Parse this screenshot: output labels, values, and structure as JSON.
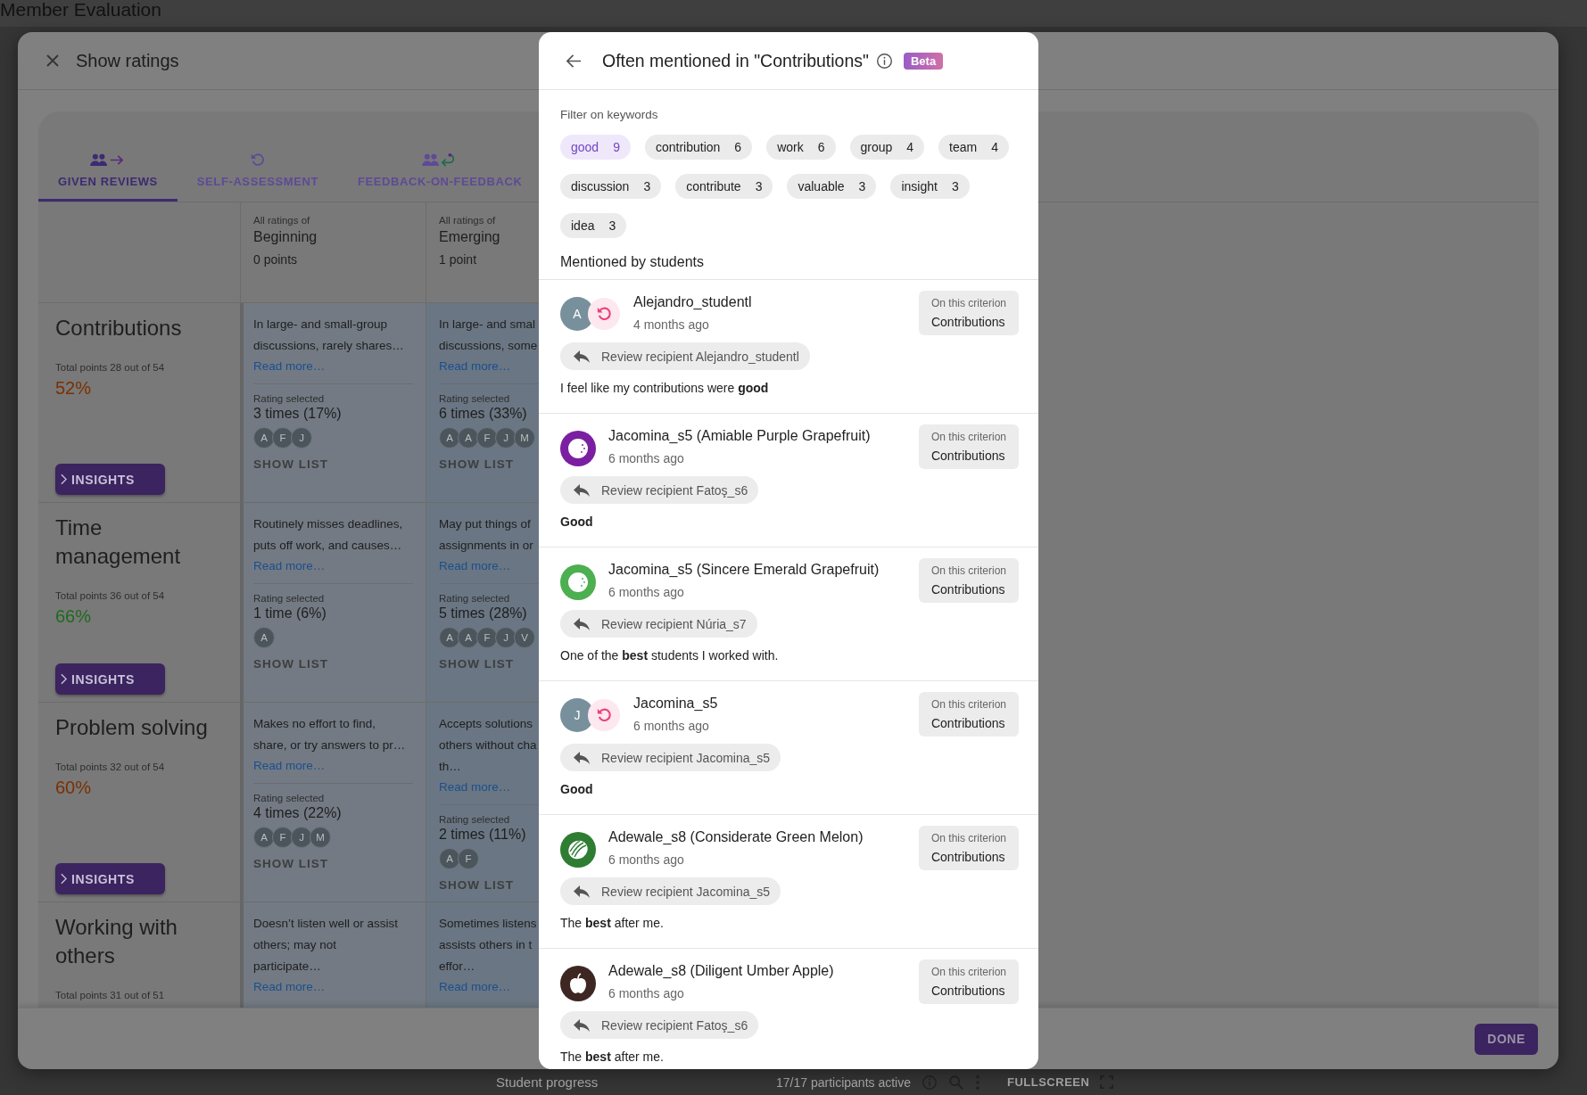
{
  "app_title": "Member Evaluation",
  "status_bar": {
    "section": "Student progress",
    "participants": "17/17 participants active",
    "fullscreen": "FULLSCREEN"
  },
  "ratings_dialog": {
    "title": "Show ratings",
    "done": "DONE",
    "tabs": [
      {
        "label": "GIVEN REVIEWS",
        "kind": "given",
        "selected": true
      },
      {
        "label": "SELF-ASSESSMENT",
        "kind": "self",
        "selected": false
      },
      {
        "label": "FEEDBACK-ON-FEEDBACK",
        "kind": "feedback",
        "selected": false
      }
    ],
    "levels": [
      {
        "caption": "All ratings of",
        "name": "Beginning",
        "points": "0 points"
      },
      {
        "caption": "All ratings of",
        "name": "Emerging",
        "points": "1 point"
      }
    ],
    "criteria": [
      {
        "name": "Contributions",
        "total": "Total points 28 out of 54",
        "percent": "52%",
        "color": "#7a3000",
        "insights": "INSIGHTS",
        "cells": [
          {
            "lines": [
              "In large- and small-group",
              "discussions, rarely shares…"
            ],
            "read_more": "Read more…",
            "rating_label": "Rating selected",
            "count": "3 times (17%)",
            "avatars": [
              "A",
              "F",
              "J"
            ],
            "show_list": "SHOW LIST"
          },
          {
            "lines": [
              "In large- and smal",
              "discussions, some"
            ],
            "read_more": "Read more…",
            "rating_label": "Rating selected",
            "count": "6 times (33%)",
            "avatars": [
              "A",
              "A",
              "F",
              "J",
              "M"
            ],
            "show_list": "SHOW LIST"
          }
        ]
      },
      {
        "name": "Time management",
        "total": "Total points 36 out of 54",
        "percent": "66%",
        "color": "#1f6a1f",
        "insights": "INSIGHTS",
        "cells": [
          {
            "lines": [
              "Routinely misses deadlines,",
              "puts off work, and causes…"
            ],
            "read_more": "Read more…",
            "rating_label": "Rating selected",
            "count": "1 time (6%)",
            "avatars": [
              "A"
            ],
            "show_list": "SHOW LIST"
          },
          {
            "lines": [
              "May put things of",
              "assignments in or"
            ],
            "read_more": "Read more…",
            "rating_label": "Rating selected",
            "count": "5 times (28%)",
            "avatars": [
              "A",
              "A",
              "F",
              "J",
              "V"
            ],
            "show_list": "SHOW LIST"
          }
        ]
      },
      {
        "name": "Problem solving",
        "total": "Total points 32 out of 54",
        "percent": "60%",
        "color": "#7a3000",
        "insights": "INSIGHTS",
        "cells": [
          {
            "lines": [
              "Makes no effort to find,",
              "share, or try answers to pr…"
            ],
            "read_more": "Read more…",
            "rating_label": "Rating selected",
            "count": "4 times (22%)",
            "avatars": [
              "A",
              "F",
              "J",
              "M"
            ],
            "show_list": "SHOW LIST"
          },
          {
            "lines": [
              "Accepts solutions",
              "others without cha",
              "th…"
            ],
            "read_more": "Read more…",
            "rating_label": "Rating selected",
            "count": "2 times (11%)",
            "avatars": [
              "A",
              "F"
            ],
            "show_list": "SHOW LIST"
          }
        ]
      },
      {
        "name": "Working with others",
        "total": "Total points 31 out of 51",
        "cells": [
          {
            "lines": [
              "Doesn’t listen well or assist",
              "others; may not",
              "participate…"
            ],
            "read_more": "Read more…"
          },
          {
            "lines": [
              "Sometimes listens",
              "assists others in t",
              "effor…"
            ],
            "read_more": "Read more…"
          }
        ]
      }
    ]
  },
  "mentions_panel": {
    "title": "Often mentioned in \"Contributions\"",
    "badge": "Beta",
    "filter_label": "Filter on keywords",
    "list_label": "Mentioned by students",
    "keywords": [
      {
        "label": "good",
        "count": "9",
        "selected": true
      },
      {
        "label": "contribution",
        "count": "6",
        "selected": false
      },
      {
        "label": "work",
        "count": "6",
        "selected": false
      },
      {
        "label": "group",
        "count": "4",
        "selected": false
      },
      {
        "label": "team",
        "count": "4",
        "selected": false
      },
      {
        "label": "discussion",
        "count": "3",
        "selected": false
      },
      {
        "label": "contribute",
        "count": "3",
        "selected": false
      },
      {
        "label": "valuable",
        "count": "3",
        "selected": false
      },
      {
        "label": "insight",
        "count": "3",
        "selected": false
      },
      {
        "label": "idea",
        "count": "3",
        "selected": false
      }
    ],
    "mentions": [
      {
        "avatar": {
          "kind": "self",
          "letter": "A"
        },
        "name": "Alejandro_studentl",
        "time": "4 months ago",
        "criterion_label": "On this criterion",
        "criterion": "Contributions",
        "recipient": "Review recipient Alejandro_studentl",
        "comment": "I feel like my contributions were **good**",
        "comment_bold": false
      },
      {
        "avatar": {
          "kind": "grapefruit",
          "color": "#7b1fa2"
        },
        "name": "Jacomina_s5 (Amiable Purple Grapefruit)",
        "time": "6 months ago",
        "criterion_label": "On this criterion",
        "criterion": "Contributions",
        "recipient": "Review recipient Fatoş_s6",
        "comment": "Good",
        "comment_bold": true
      },
      {
        "avatar": {
          "kind": "grapefruit",
          "color": "#4caf50"
        },
        "name": "Jacomina_s5 (Sincere Emerald Grapefruit)",
        "time": "6 months ago",
        "criterion_label": "On this criterion",
        "criterion": "Contributions",
        "recipient": "Review recipient Núria_s7",
        "comment": "One of the **best** students I worked with.",
        "comment_bold": false
      },
      {
        "avatar": {
          "kind": "self",
          "letter": "J"
        },
        "name": "Jacomina_s5",
        "time": "6 months ago",
        "criterion_label": "On this criterion",
        "criterion": "Contributions",
        "recipient": "Review recipient Jacomina_s5",
        "comment": "Good",
        "comment_bold": true
      },
      {
        "avatar": {
          "kind": "melon",
          "color": "#2e7d32"
        },
        "name": "Adewale_s8 (Considerate Green Melon)",
        "time": "6 months ago",
        "criterion_label": "On this criterion",
        "criterion": "Contributions",
        "recipient": "Review recipient Jacomina_s5",
        "comment": "The **best** after me.",
        "comment_bold": false
      },
      {
        "avatar": {
          "kind": "apple",
          "color": "#3e2723"
        },
        "name": "Adewale_s8 (Diligent Umber Apple)",
        "time": "6 months ago",
        "criterion_label": "On this criterion",
        "criterion": "Contributions",
        "recipient": "Review recipient Fatoş_s6",
        "comment": "The **best** after me.",
        "comment_bold": false
      }
    ]
  }
}
